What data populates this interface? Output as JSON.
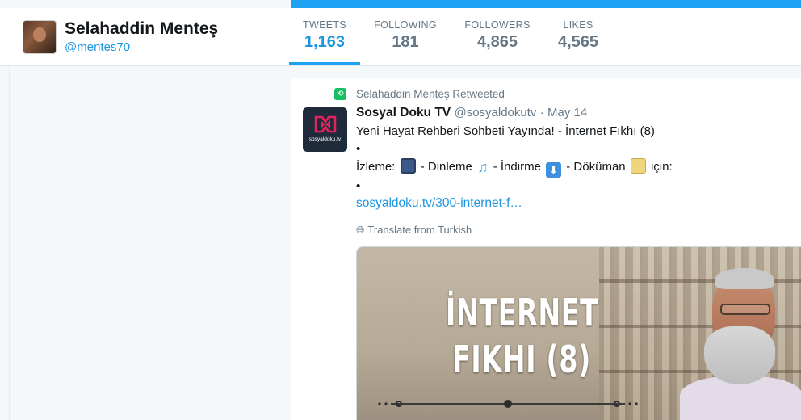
{
  "profile": {
    "name": "Selahaddin Menteş",
    "handle": "@mentes70"
  },
  "stats": [
    {
      "label": "TWEETS",
      "value": "1,163",
      "active": true
    },
    {
      "label": "FOLLOWING",
      "value": "181",
      "active": false
    },
    {
      "label": "FOLLOWERS",
      "value": "4,865",
      "active": false
    },
    {
      "label": "LIKES",
      "value": "4,565",
      "active": false
    }
  ],
  "tweet": {
    "retweet_context": "Selahaddin Menteş Retweeted",
    "author_name": "Sosyal Doku TV",
    "author_handle": "@sosyaldokutv",
    "separator": "·",
    "date": "May 14",
    "avatar_logo_text": "sosyaldoku.tv",
    "text_line1": "Yeni Hayat Rehberi Sohbeti Yayında! - İnternet Fıkhı (8)",
    "text_line2": "•",
    "text_line3_a": "İzleme:",
    "text_line3_b": "- Dinleme",
    "text_line3_c": "- İndirme",
    "text_line3_d": "- Döküman",
    "text_line3_e": "için:",
    "text_line4": "•",
    "link": "sosyaldoku.tv/300-internet-f…",
    "translate": "Translate from Turkish",
    "media_title_line1": "İNTERNET",
    "media_title_line2": "FIKHI (8)",
    "emoji_icons": [
      "tv-icon",
      "music-note-icon",
      "down-arrow-icon",
      "memo-icon"
    ]
  },
  "colors": {
    "accent": "#1da1f2",
    "link": "#1b95e0",
    "muted": "#657786",
    "retweet": "#17bf63"
  }
}
